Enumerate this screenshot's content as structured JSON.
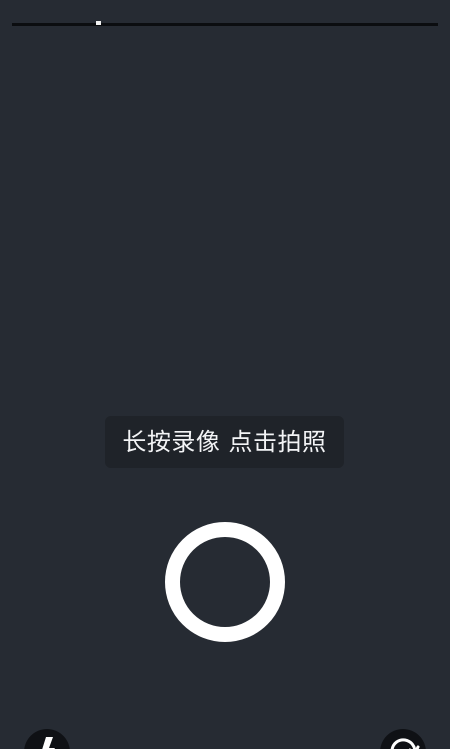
{
  "camera": {
    "progress": 0.2,
    "hint_text": "长按录像 点击拍照",
    "icons": {
      "left_action": "flash-icon",
      "right_action": "switch-camera-icon",
      "shutter": "capture-ring"
    },
    "colors": {
      "background": "#262b33",
      "progress_track": "#0b0d10",
      "progress_marker": "#f2f2f2",
      "hint_background": "#1f2329",
      "hint_text": "#f3f4f6",
      "shutter_ring": "#ffffff",
      "corner_button": "#0f1115"
    }
  }
}
